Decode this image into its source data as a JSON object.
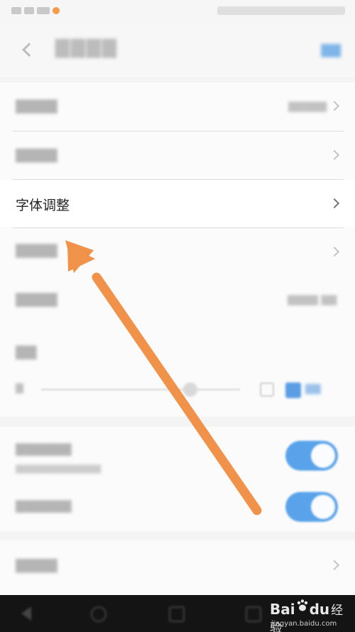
{
  "rows": {
    "font_adjust": {
      "label": "字体调整"
    }
  },
  "watermark": {
    "brand_main": "Bai",
    "brand_du": "du",
    "brand_jingyan": "经验",
    "url": "jingyan.baidu.com"
  },
  "icons": {
    "back": "chevron-left-icon",
    "row_arrow": "chevron-right-icon",
    "annotation": "orange-arrow-annotation"
  },
  "colors": {
    "accent_blue": "#5aa3ea",
    "annotation_orange": "#f0924a",
    "nav_bar": "#141414"
  }
}
